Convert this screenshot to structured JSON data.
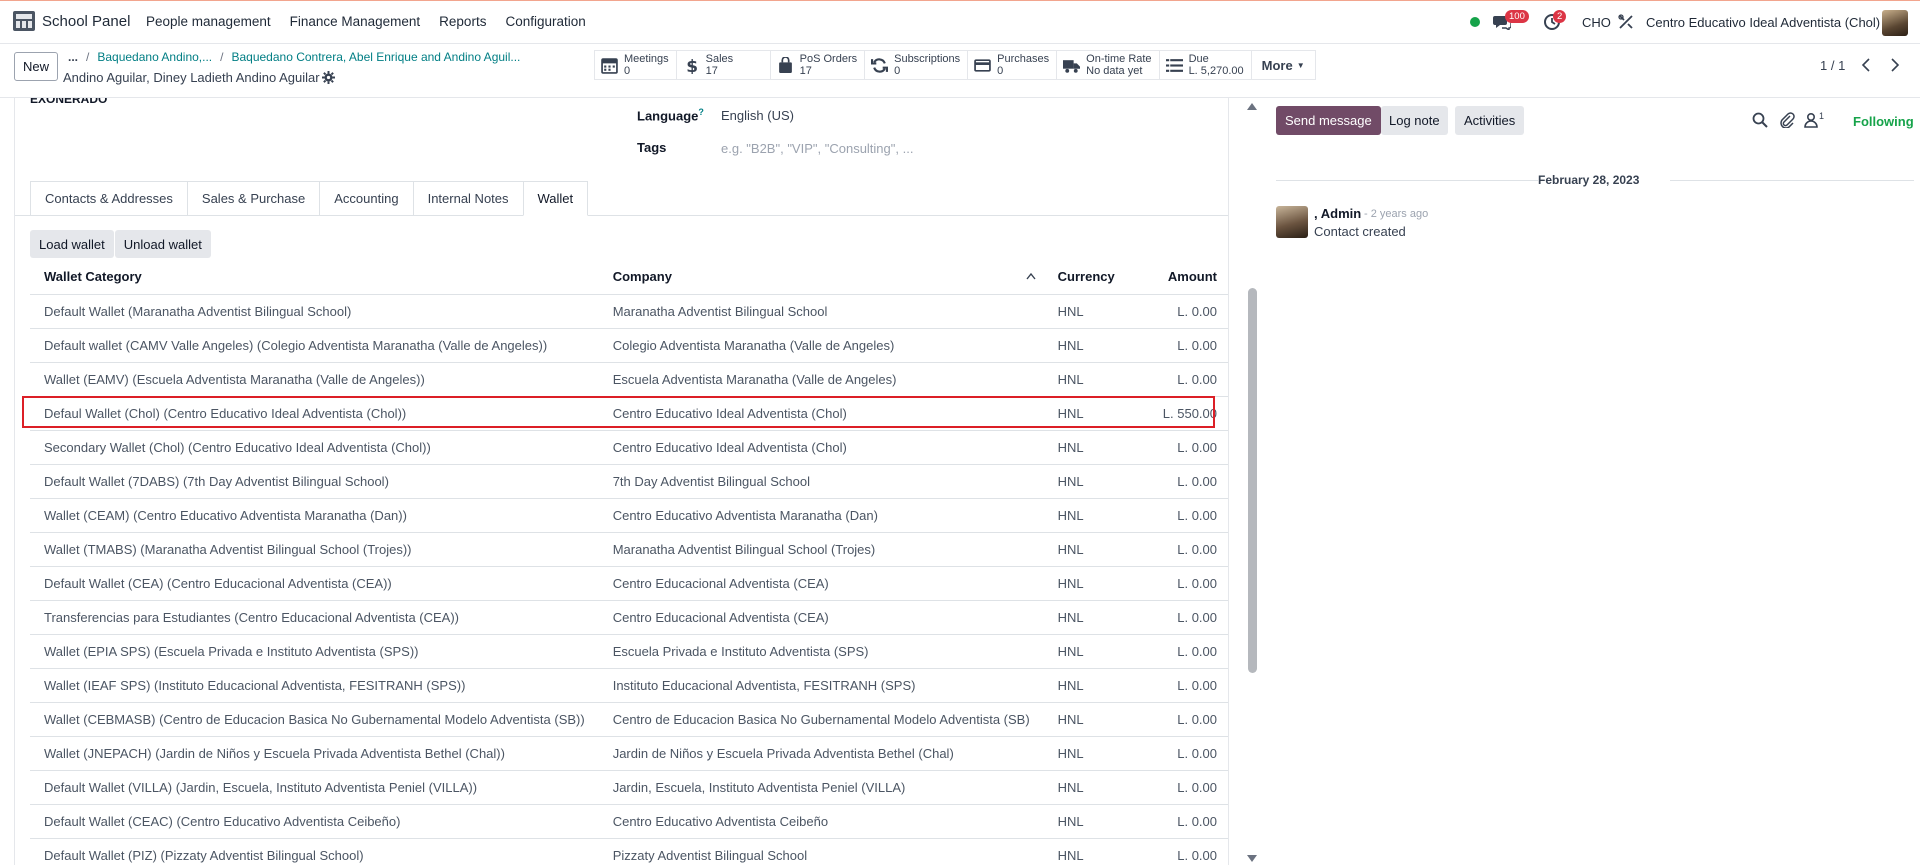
{
  "topbar": {
    "app_name": "School Panel",
    "menu": [
      "People management",
      "Finance Management",
      "Reports",
      "Configuration"
    ],
    "messages_count": "100",
    "activities_count": "2",
    "company_code": "CHO",
    "company_name": "Centro Educativo Ideal Adventista (Chol)",
    "status_color": "#16a34a"
  },
  "control": {
    "new_label": "New",
    "breadcrumb_ellipsis": "...",
    "breadcrumbs": [
      "Baquedano Andino,...",
      "Baquedano Contrera, Abel Enrique and Andino Aguil..."
    ],
    "record_title": "Andino Aguilar, Diney Ladieth Andino Aguilar",
    "stats": [
      {
        "label": "Meetings",
        "value": "0",
        "icon": "calendar-icon"
      },
      {
        "label": "Sales",
        "value": "17",
        "icon": "dollar-icon"
      },
      {
        "label": "PoS Orders",
        "value": "17",
        "icon": "shopping-bag-icon"
      },
      {
        "label": "Subscriptions",
        "value": "0",
        "icon": "refresh-icon"
      },
      {
        "label": "Purchases",
        "value": "0",
        "icon": "credit-card-icon"
      },
      {
        "label": "On-time Rate",
        "value": "No data yet",
        "icon": "truck-icon"
      },
      {
        "label": "Due",
        "value": "L. 5,270.00",
        "icon": "list-icon"
      }
    ],
    "more_label": "More",
    "pager": "1 / 1"
  },
  "form": {
    "partial_text": "EXONERADO",
    "language_label": "Language",
    "language_help": "?",
    "language_value": "English (US)",
    "tags_label": "Tags",
    "tags_placeholder": "e.g. \"B2B\", \"VIP\", \"Consulting\", ...",
    "tabs": [
      "Contacts & Addresses",
      "Sales & Purchase",
      "Accounting",
      "Internal Notes",
      "Wallet"
    ],
    "active_tab": "Wallet"
  },
  "wallet": {
    "load_label": "Load wallet",
    "unload_label": "Unload wallet",
    "columns": [
      "Wallet Category",
      "Company",
      "Currency",
      "Amount"
    ],
    "rows": [
      [
        "Default Wallet (Maranatha Adventist Bilingual School)",
        "Maranatha Adventist Bilingual School",
        "HNL",
        "L. 0.00"
      ],
      [
        "Default wallet (CAMV Valle Angeles) (Colegio Adventista Maranatha (Valle de Angeles))",
        "Colegio Adventista Maranatha (Valle de Angeles)",
        "HNL",
        "L. 0.00"
      ],
      [
        "Wallet (EAMV) (Escuela Adventista Maranatha (Valle de Angeles))",
        "Escuela Adventista Maranatha (Valle de Angeles)",
        "HNL",
        "L. 0.00"
      ],
      [
        "Defaul Wallet (Chol) (Centro Educativo Ideal Adventista (Chol))",
        "Centro Educativo Ideal Adventista (Chol)",
        "HNL",
        "L. 550.00"
      ],
      [
        "Secondary Wallet (Chol) (Centro Educativo Ideal Adventista (Chol))",
        "Centro Educativo Ideal Adventista (Chol)",
        "HNL",
        "L. 0.00"
      ],
      [
        "Default Wallet (7DABS) (7th Day Adventist Bilingual School)",
        "7th Day Adventist Bilingual School",
        "HNL",
        "L. 0.00"
      ],
      [
        "Wallet (CEAM) (Centro Educativo Adventista Maranatha (Dan))",
        "Centro Educativo Adventista Maranatha (Dan)",
        "HNL",
        "L. 0.00"
      ],
      [
        "Wallet (TMABS) (Maranatha Adventist Bilingual School (Trojes))",
        "Maranatha Adventist Bilingual School (Trojes)",
        "HNL",
        "L. 0.00"
      ],
      [
        "Default Wallet (CEA) (Centro Educacional Adventista (CEA))",
        "Centro Educacional Adventista (CEA)",
        "HNL",
        "L. 0.00"
      ],
      [
        "Transferencias para Estudiantes (Centro Educacional Adventista (CEA))",
        "Centro Educacional Adventista (CEA)",
        "HNL",
        "L. 0.00"
      ],
      [
        "Wallet (EPIA SPS) (Escuela Privada e Instituto Adventista (SPS))",
        "Escuela Privada e Instituto Adventista (SPS)",
        "HNL",
        "L. 0.00"
      ],
      [
        "Wallet (IEAF SPS) (Instituto Educacional Adventista, FESITRANH (SPS))",
        "Instituto Educacional Adventista, FESITRANH (SPS)",
        "HNL",
        "L. 0.00"
      ],
      [
        "Wallet (CEBMASB) (Centro de Educacion Basica No Gubernamental Modelo Adventista (SB))",
        "Centro de Educacion Basica No Gubernamental Modelo Adventista (SB)",
        "HNL",
        "L. 0.00"
      ],
      [
        "Wallet (JNEPACH) (Jardin de Niños y Escuela Privada Adventista Bethel (Chal))",
        "Jardin de Niños y Escuela Privada Adventista Bethel (Chal)",
        "HNL",
        "L. 0.00"
      ],
      [
        "Default Wallet (VILLA) (Jardin, Escuela, Instituto Adventista Peniel (VILLA))",
        "Jardin, Escuela, Instituto Adventista Peniel (VILLA)",
        "HNL",
        "L. 0.00"
      ],
      [
        "Default Wallet (CEAC) (Centro Educativo Adventista Ceibeño)",
        "Centro Educativo Adventista Ceibeño",
        "HNL",
        "L. 0.00"
      ],
      [
        "Default Wallet (PIZ) (Pizzaty Adventist Bilingual School)",
        "Pizzaty Adventist Bilingual School",
        "HNL",
        "L. 0.00"
      ]
    ],
    "highlighted_row": 3,
    "highlight_color": "#dc1f26"
  },
  "chatter": {
    "send_label": "Send message",
    "log_label": "Log note",
    "activities_label": "Activities",
    "followers_count": "1",
    "following_label": "Following",
    "date": "February 28, 2023",
    "author": ", Admin",
    "time": "- 2 years ago",
    "body": "Contact created",
    "accent_color": "#714b67"
  }
}
